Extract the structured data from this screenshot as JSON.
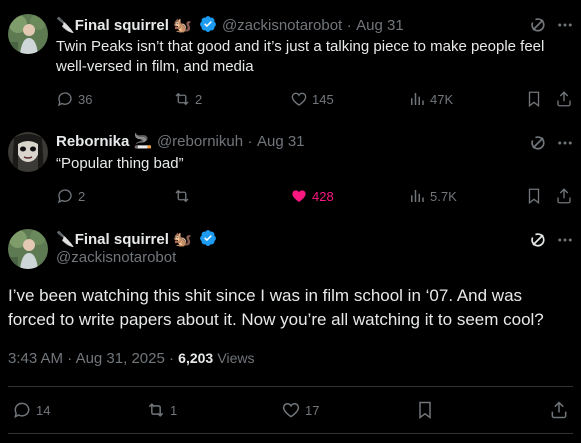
{
  "tweets": [
    {
      "display_name": "Final squirrel",
      "handle": "@zackisnotarobot",
      "date": "Aug 31",
      "text": "Twin Peaks isn’t that good and it’s just a talking piece to make people feel well-versed in film, and media",
      "replies": "36",
      "retweets": "2",
      "likes": "145",
      "views": "47K"
    },
    {
      "display_name": "Rebornika",
      "handle": "@rebornikuh",
      "date": "Aug 31",
      "text": "“Popular thing bad”",
      "replies": "2",
      "retweets": "",
      "likes": "428",
      "views": "5.7K"
    }
  ],
  "main_tweet": {
    "display_name": "Final squirrel",
    "handle": "@zackisnotarobot",
    "text": "I’ve been watching this shit since I was in film school in ‘07. And was forced to write papers about it. Now you’re all watching it to seem cool?",
    "time": "3:43 AM",
    "date": "Aug 31, 2025",
    "views_count": "6,203",
    "views_label": "Views",
    "replies": "14",
    "retweets": "1",
    "likes": "17"
  },
  "separator": "·",
  "colors": {
    "background": "#000000",
    "text": "#e7e9ea",
    "muted": "#71767b",
    "verified": "#1d9bf0",
    "liked": "#f91880",
    "divider": "#2f3336"
  }
}
